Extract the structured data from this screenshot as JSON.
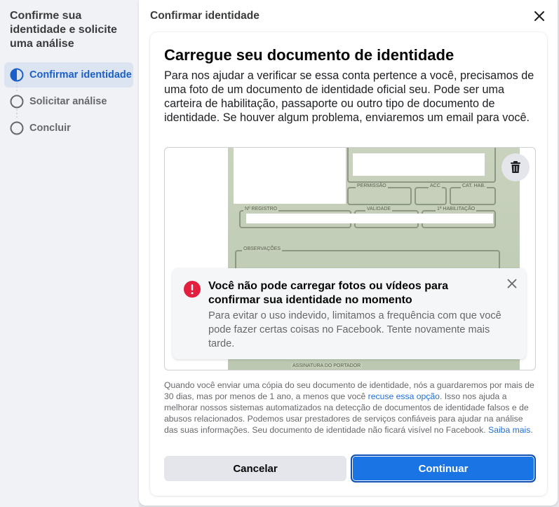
{
  "sidebar": {
    "title": "Confirme sua identidade e solicite uma análise",
    "steps": [
      {
        "label": "Confirmar identidade",
        "state": "active"
      },
      {
        "label": "Solicitar análise",
        "state": "pending"
      },
      {
        "label": "Concluir",
        "state": "pending"
      }
    ]
  },
  "dialog": {
    "title": "Confirmar identidade",
    "heading": "Carregue seu documento de identidade",
    "description": "Para nos ajudar a verificar se essa conta pertence a você, precisamos de uma foto de um documento de identidade oficial seu. Pode ser uma carteira de habilitação, passaporte ou outro tipo de documento de identidade. Se houver algum problema, enviaremos um email para você."
  },
  "document": {
    "labels": {
      "permissao": "PERMISSÃO",
      "acc": "ACC",
      "cat_hab": "CAT. HAB.",
      "registro": "Nº REGISTRO",
      "validade": "VALIDADE",
      "habilitacao": "1ª HABILITAÇÃO",
      "observacoes": "OBSERVAÇÕES",
      "assinatura": "ASSINATURA DO PORTADOR"
    }
  },
  "error": {
    "title": "Você não pode carregar fotos ou vídeos para confirmar sua identidade no momento",
    "body": "Para evitar o uso indevido, limitamos a frequência com que você pode fazer certas coisas no Facebook. Tente novamente mais tarde."
  },
  "legal": {
    "part1": "Quando você enviar uma cópia do seu documento de identidade, nós a guardaremos por mais de 30 dias, mas por menos de 1 ano, a menos que você ",
    "link1": "recuse essa opção",
    "part2": ". Isso nos ajuda a melhorar nossos sistemas automatizados na detecção de documentos de identidade falsos e de abusos relacionados. Podemos usar prestadores de serviços confiáveis para ajudar na análise das suas informações. Seu documento de identidade não ficará visível no Facebook. ",
    "link2": "Saiba mais",
    "part3": "."
  },
  "buttons": {
    "cancel": "Cancelar",
    "continue": "Continuar"
  },
  "colors": {
    "accent": "#1b74e4",
    "link": "#216fdb",
    "error": "#e41e3f",
    "active_step_bg": "#dbe4f0"
  },
  "icons": {
    "close": "close-icon",
    "trash": "trash-icon",
    "error": "error-icon",
    "step_active": "half-circle-icon",
    "step_pending": "empty-circle-icon"
  }
}
